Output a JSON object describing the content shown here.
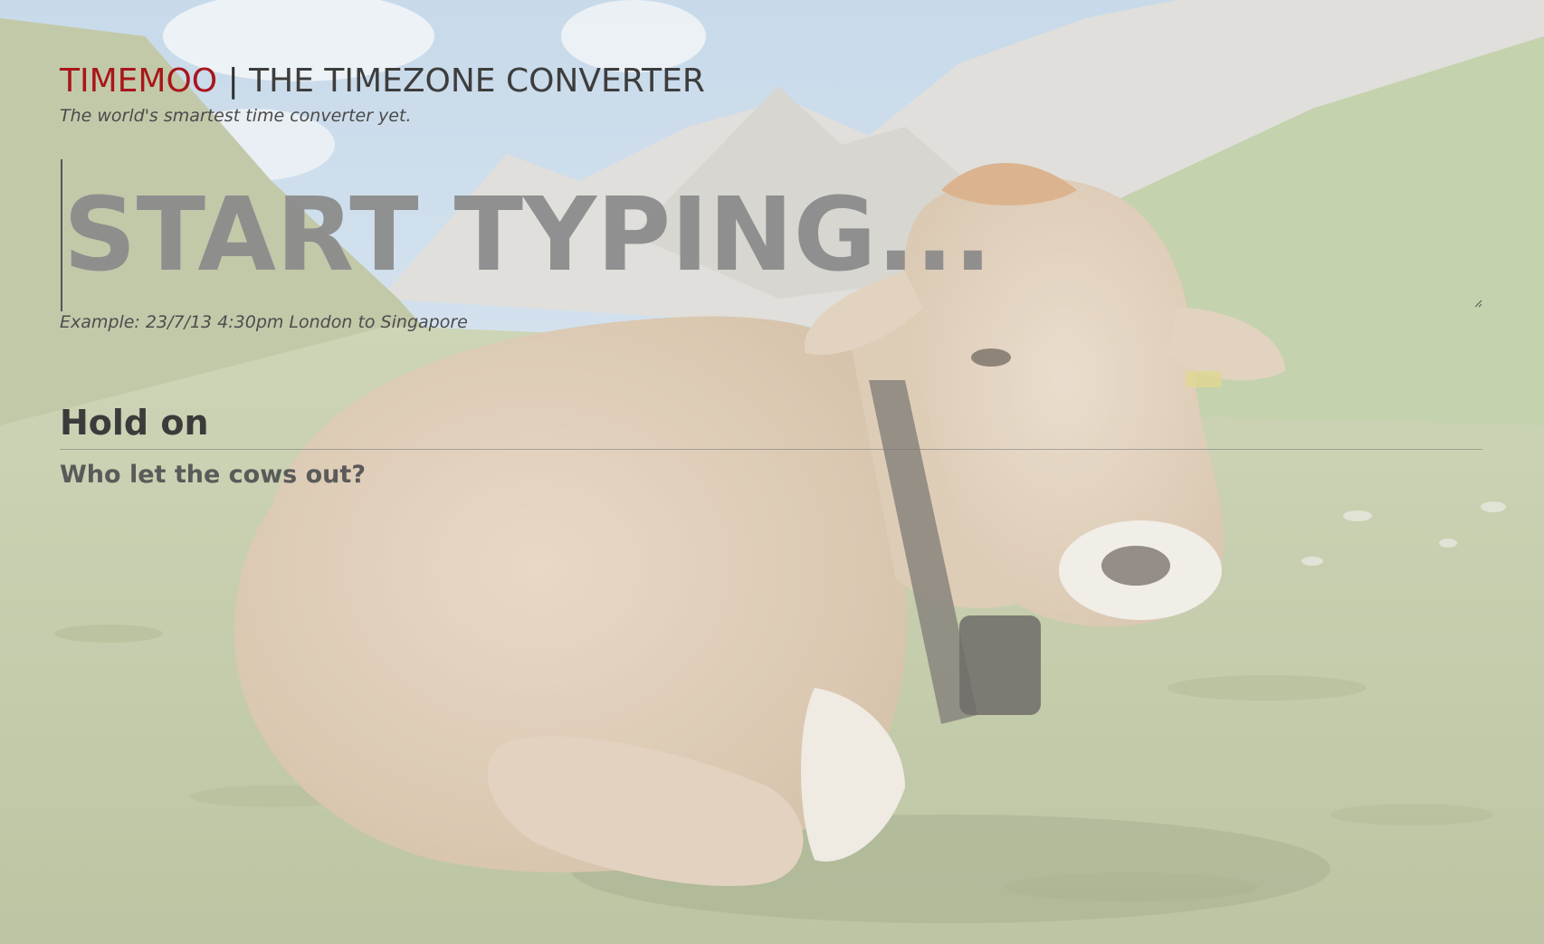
{
  "header": {
    "brand_name": "TIMEMOO",
    "brand_separator": " | ",
    "brand_title": "THE TIMEZONE CONVERTER",
    "tagline": "The world's smartest time converter yet."
  },
  "converter": {
    "input_placeholder": "START TYPING...",
    "input_value": "",
    "example": "Example: 23/7/13 4:30pm London to Singapore"
  },
  "result": {
    "title": "Hold on",
    "subtitle": "Who let the cows out?"
  },
  "background": {
    "image_subject": "cow lying in alpine meadow with mountains and sky",
    "colors": {
      "sky": "#c9d9e6",
      "mountain": "#d9d6cf",
      "meadow": "#b9c3a2",
      "cow": "#d8c4ad",
      "accent_brand": "#a8161a"
    }
  }
}
